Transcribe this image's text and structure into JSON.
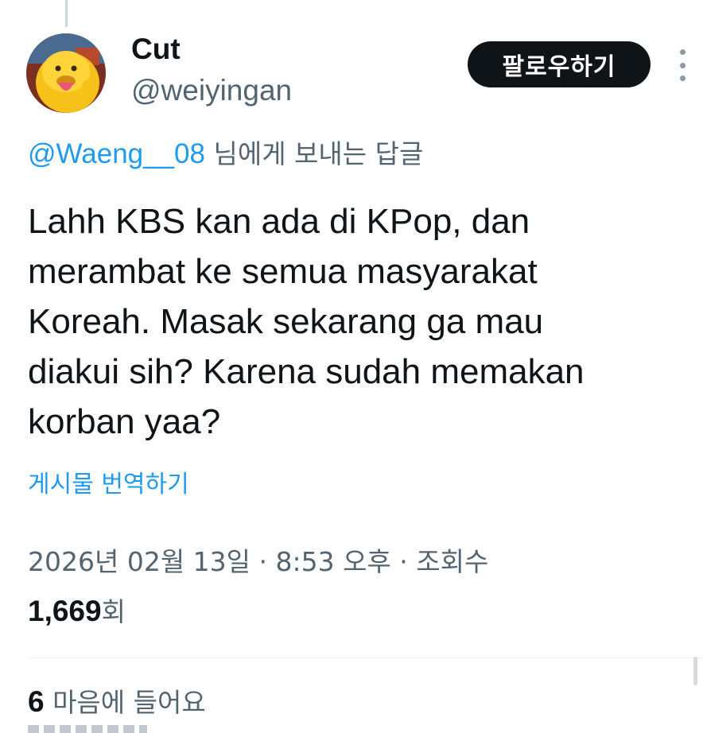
{
  "author": {
    "display_name": "Cut",
    "handle": "@weiyingan",
    "avatar_icon": "yellow-cartoon-duck-avatar"
  },
  "actions": {
    "follow_label": "팔로우하기",
    "more_icon": "more-vertical-icon"
  },
  "reply": {
    "mention": "@Waeng__08",
    "suffix": " 님에게 보내는 답글"
  },
  "tweet": {
    "text": "Lahh KBS kan ada di KPop, dan\nmerambat ke semua masyarakat\nKoreah. Masak sekarang ga mau\ndiakui sih? Karena sudah memakan\nkorban yaa?",
    "translate_label": "게시물 번역하기"
  },
  "meta": {
    "timestamp": "2026년 02월 13일 · 8:53 오후 · 조회수",
    "views_count": "1,669",
    "views_unit": "회"
  },
  "engagement": {
    "likes_count": "6",
    "likes_label": " 마음에 들어요"
  },
  "colors": {
    "text": "#0f1419",
    "secondary": "#536471",
    "accent": "#1d9bf0",
    "button_bg": "#0f1419",
    "divider": "#eff3f4"
  }
}
